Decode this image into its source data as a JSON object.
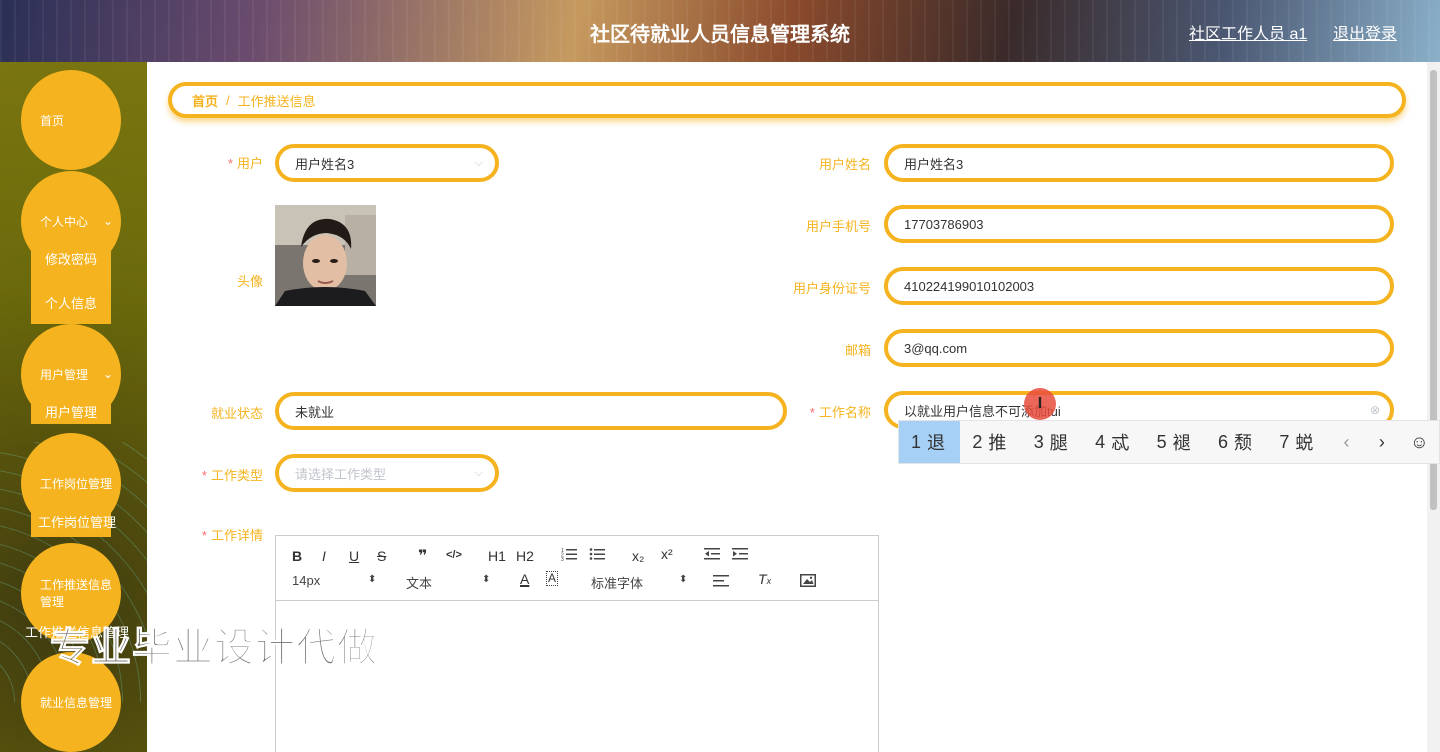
{
  "header": {
    "title": "社区待就业人员信息管理系统",
    "user": "社区工作人员 a1",
    "logout": "退出登录"
  },
  "sidebar": {
    "home": "首页",
    "personal_center": "个人中心",
    "change_password": "修改密码",
    "personal_info": "个人信息",
    "user_management": "用户管理",
    "user_management_sub": "用户管理",
    "job_position_management": "工作岗位管理",
    "job_position_management_sub": "工作岗位管理",
    "job_push_management": "工作推送信息管理",
    "job_push_management_sub": "工作推送信息管理",
    "employment_info_management": "就业信息管理"
  },
  "breadcrumb": {
    "home": "首页",
    "separator": "/",
    "current": "工作推送信息"
  },
  "form": {
    "user": {
      "label": "用户",
      "value": "用户姓名3"
    },
    "avatar": {
      "label": "头像"
    },
    "employment_status": {
      "label": "就业状态",
      "value": "未就业"
    },
    "job_type": {
      "label": "工作类型",
      "placeholder": "请选择工作类型"
    },
    "job_details": {
      "label": "工作详情"
    },
    "user_name": {
      "label": "用户姓名",
      "value": "用户姓名3"
    },
    "user_phone": {
      "label": "用户手机号",
      "value": "17703786903"
    },
    "user_id_number": {
      "label": "用户身份证号",
      "value": "410224199010102003"
    },
    "email": {
      "label": "邮箱",
      "value": "3@qq.com"
    },
    "job_name": {
      "label": "工作名称",
      "value": "以就业用户信息不可添加tui"
    }
  },
  "ime": {
    "candidates": [
      {
        "num": "1",
        "char": "退"
      },
      {
        "num": "2",
        "char": "推"
      },
      {
        "num": "3",
        "char": "腿"
      },
      {
        "num": "4",
        "char": "忒"
      },
      {
        "num": "5",
        "char": "褪"
      },
      {
        "num": "6",
        "char": "颓"
      },
      {
        "num": "7",
        "char": "蜕"
      }
    ],
    "prev": "‹",
    "next": "›",
    "emoji": "☺"
  },
  "editor": {
    "font_size": "14px",
    "header_select": "文本",
    "font_select": "标准字体",
    "buttons": {
      "bold": "B",
      "italic": "I",
      "underline": "U",
      "strike": "S",
      "quote": "❞",
      "code": "</>",
      "h1": "H1",
      "h2": "H2",
      "sub": "x₂",
      "sup": "x²"
    }
  },
  "watermark": "专业毕业设计代做",
  "colors": {
    "accent": "#f5b31f",
    "required": "#f56c6c"
  }
}
